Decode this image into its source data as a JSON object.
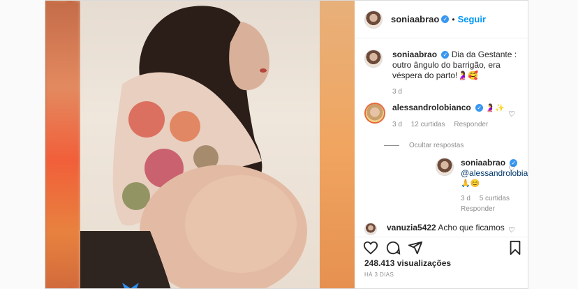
{
  "header": {
    "username": "soniaabrao",
    "separator": "•",
    "follow_label": "Seguir",
    "verified_mark": "✓"
  },
  "caption": {
    "username": "soniaabrao",
    "text": "Dia da Gestante : outro ângulo do barrigão, era véspera do parto!🤰🥰",
    "time": "3 d"
  },
  "comments": [
    {
      "username": "alessandrolobianco",
      "text": "🤰✨",
      "time": "3 d",
      "likes": "12 curtidas",
      "reply_label": "Responder"
    }
  ],
  "hide_replies_label": "Ocultar respostas",
  "reply": {
    "username": "soniaabrao",
    "mention": "@alessandrolobianco",
    "text": "🙏😊",
    "time": "3 d",
    "likes": "5 curtidas",
    "reply_label": "Responder"
  },
  "next_comment": {
    "username": "vanuzia5422",
    "text": "Acho que ficamos"
  },
  "footer": {
    "views": "248.413 visualizações",
    "posted_ago": "HÁ 3 DIAS"
  },
  "icons": [
    "heart-icon",
    "comment-icon",
    "share-icon",
    "bookmark-icon"
  ],
  "colors": {
    "follow": "#0095f6",
    "verified": "#3897f0",
    "secondary_text": "#8e8e8e"
  }
}
